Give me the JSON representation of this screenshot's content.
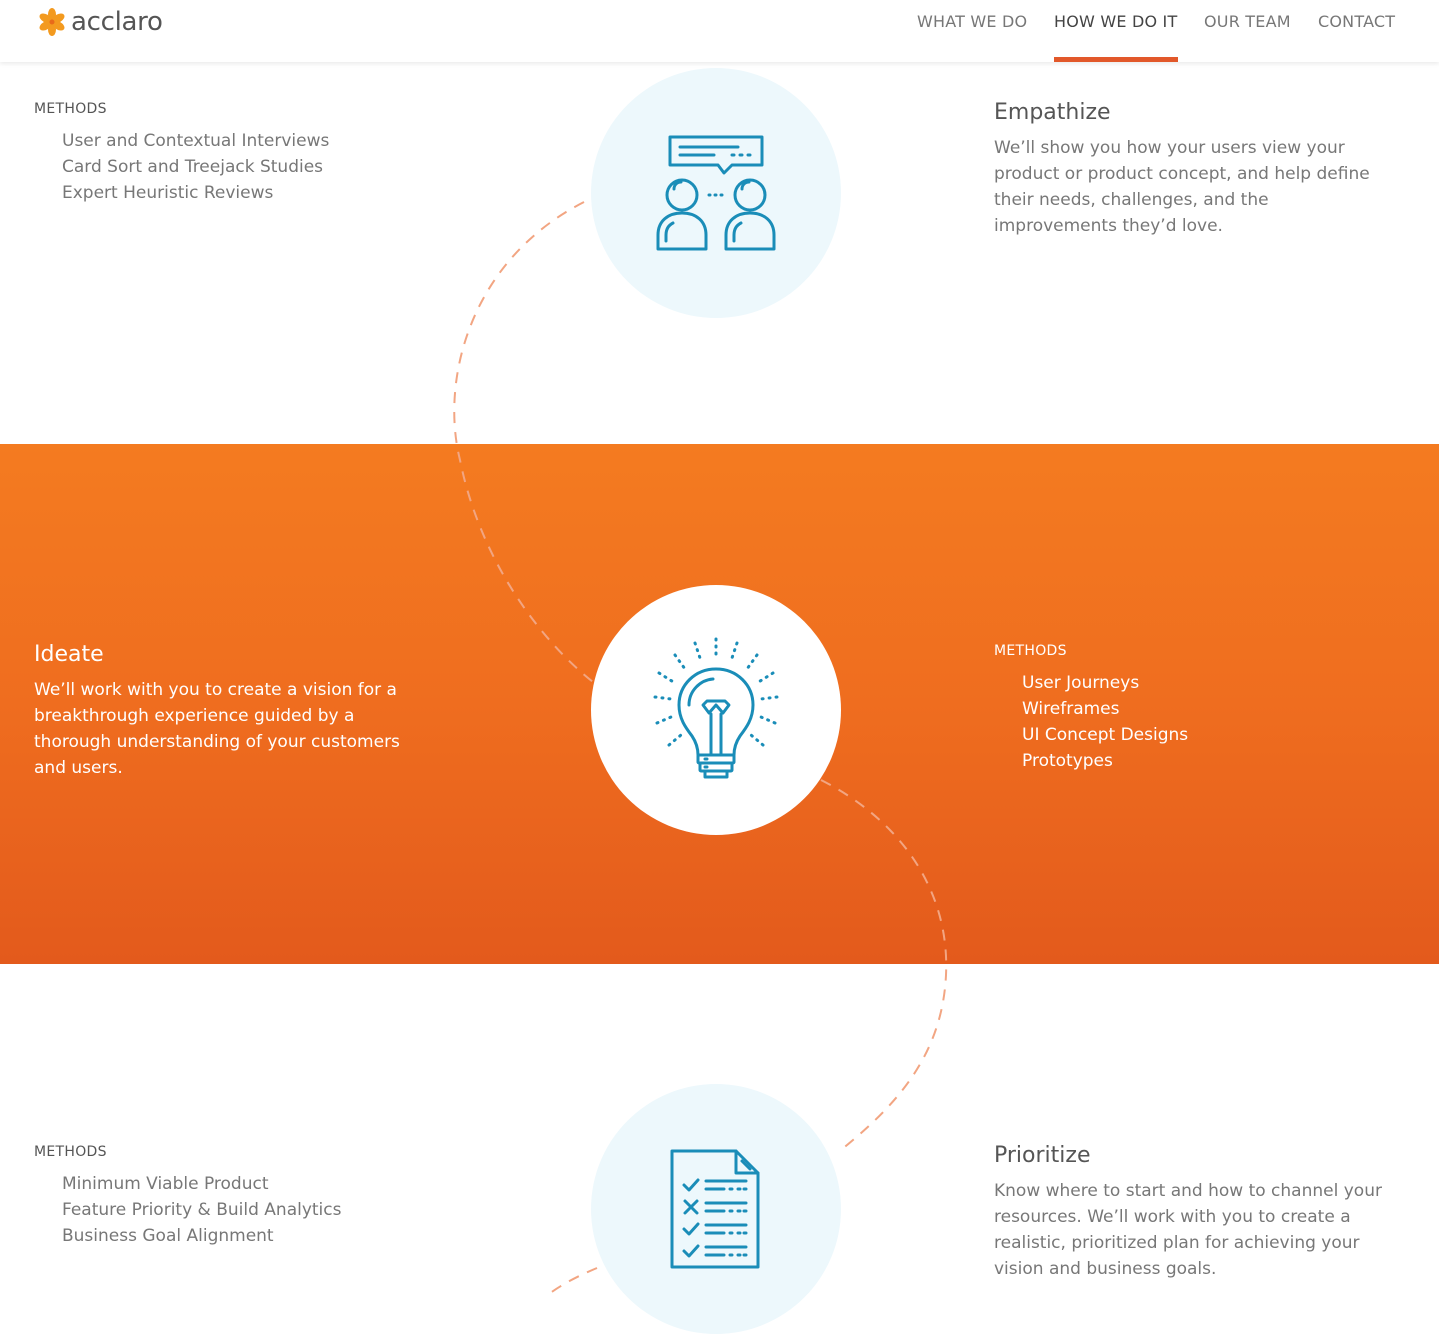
{
  "brand": {
    "name": "acclaro",
    "accent_color": "#e2582a",
    "icon_color": "#1a8db8"
  },
  "nav": {
    "items": [
      {
        "label": "WHAT WE DO"
      },
      {
        "label": "HOW WE DO IT",
        "active": true
      },
      {
        "label": "OUR TEAM"
      },
      {
        "label": "CONTACT"
      }
    ]
  },
  "steps": {
    "empathize": {
      "title": "Empathize",
      "description": "We’ll show you how your users view your product or product concept, and help define their needs, challenges, and the improvements they’d love.",
      "methods_label": "METHODS",
      "methods": [
        "User and Contextual Interviews",
        "Card Sort and Treejack Studies",
        "Expert Heuristic Reviews"
      ],
      "icon": "conversation-icon"
    },
    "ideate": {
      "title": "Ideate",
      "description": "We’ll work with you to create a vision for a breakthrough experience guided by a thorough understanding of your customers and users.",
      "methods_label": "METHODS",
      "methods": [
        "User Journeys",
        "Wireframes",
        "UI Concept Designs",
        "Prototypes"
      ],
      "icon": "lightbulb-icon"
    },
    "prioritize": {
      "title": "Prioritize",
      "description": "Know where to start and how to channel your resources. We’ll work with you to create a realistic, prioritized plan for achieving your vision and business goals.",
      "methods_label": "METHODS",
      "methods": [
        "Minimum Viable Product",
        "Feature Priority & Build Analytics",
        "Business Goal Alignment"
      ],
      "icon": "checklist-icon"
    }
  }
}
